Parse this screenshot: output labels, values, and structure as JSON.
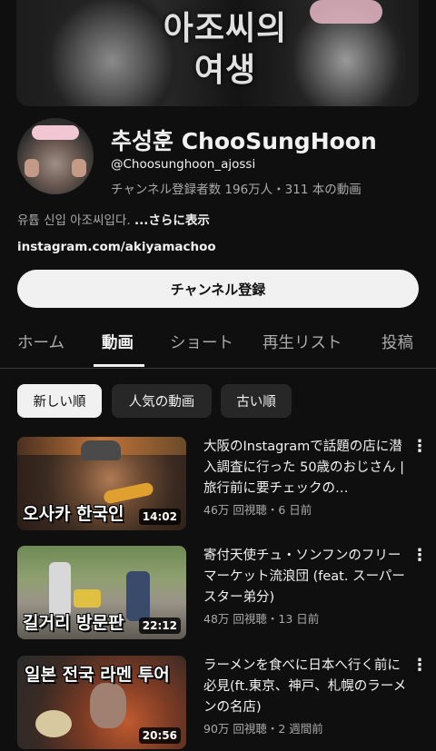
{
  "banner": {
    "title_line1": "아조씨의",
    "title_line2": "여생"
  },
  "channel": {
    "name": "추성훈 ChooSungHoon",
    "handle": "@Choosunghoon_ajossi",
    "stats": "チャンネル登録者数 196万人・311 本の動画",
    "description": "유튭 신입 아조씨입다.",
    "more_label": "...さらに表示",
    "link": "instagram.com/akiyamachoo",
    "subscribe_label": "チャンネル登録"
  },
  "tabs": [
    {
      "label": "ホーム"
    },
    {
      "label": "動画"
    },
    {
      "label": "ショート"
    },
    {
      "label": "再生リスト"
    },
    {
      "label": "投稿"
    }
  ],
  "chips": [
    {
      "label": "新しい順"
    },
    {
      "label": "人気の動画"
    },
    {
      "label": "古い順"
    }
  ],
  "videos": [
    {
      "title": "大阪のInstagramで話題の店に潜入調査に行った 50歳のおじさん | 旅行前に要チェックの…",
      "meta": "46万 回視聴・6 日前",
      "duration": "14:02",
      "thumb_text": "오사카 한국인"
    },
    {
      "title": "寄付天使チュ・ソンフンのフリーマーケット流浪団 (feat. スーパースター弟分)",
      "meta": "48万 回視聴・13 日前",
      "duration": "22:12",
      "thumb_text": "길거리 방문판"
    },
    {
      "title": "ラーメンを食べに日本へ行く前に必見(ft.東京、神戸、札幌のラーメンの名店)",
      "meta": "90万 回視聴・2 週間前",
      "duration": "20:56",
      "thumb_text": "일본 전국 라멘 투어"
    }
  ],
  "icons": {
    "menu": "kebab-menu-icon"
  }
}
